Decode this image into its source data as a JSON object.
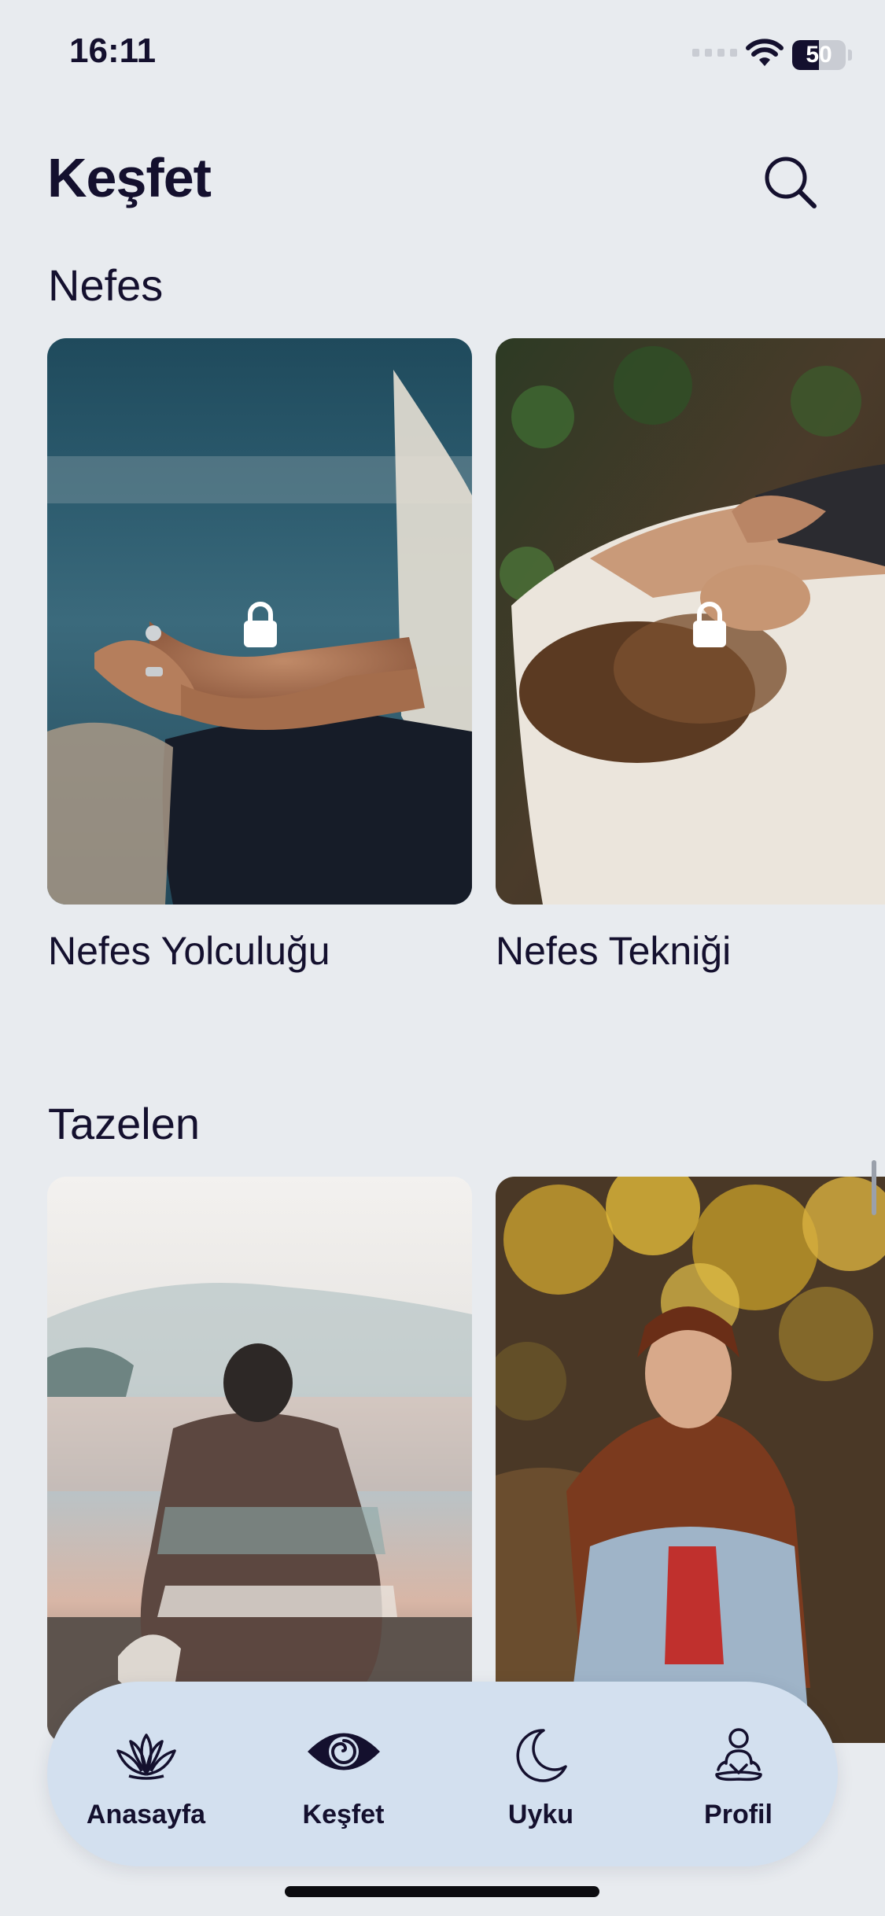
{
  "status_bar": {
    "time": "16:11",
    "battery": "50",
    "battery_level": 0.5
  },
  "header": {
    "title": "Keşfet",
    "search_icon": "search-icon"
  },
  "sections": [
    {
      "title": "Nefes",
      "cards": [
        {
          "label": "Nefes Yolculuğu",
          "locked": true,
          "image": "meditation-hands-photo"
        },
        {
          "label": "Nefes Tekniği",
          "locked": true,
          "image": "woman-lying-on-rug-photo"
        }
      ]
    },
    {
      "title": "Tazelen",
      "cards": [
        {
          "label": "",
          "locked": false,
          "image": "person-in-blanket-by-lake-photo"
        },
        {
          "label": "",
          "locked": false,
          "image": "woman-under-yellow-tree-photo"
        }
      ]
    }
  ],
  "tab_bar": {
    "items": [
      {
        "label": "Anasayfa",
        "icon": "lotus-icon"
      },
      {
        "label": "Keşfet",
        "icon": "eye-icon",
        "active": true
      },
      {
        "label": "Uyku",
        "icon": "moon-icon"
      },
      {
        "label": "Profil",
        "icon": "meditating-person-icon"
      }
    ]
  }
}
